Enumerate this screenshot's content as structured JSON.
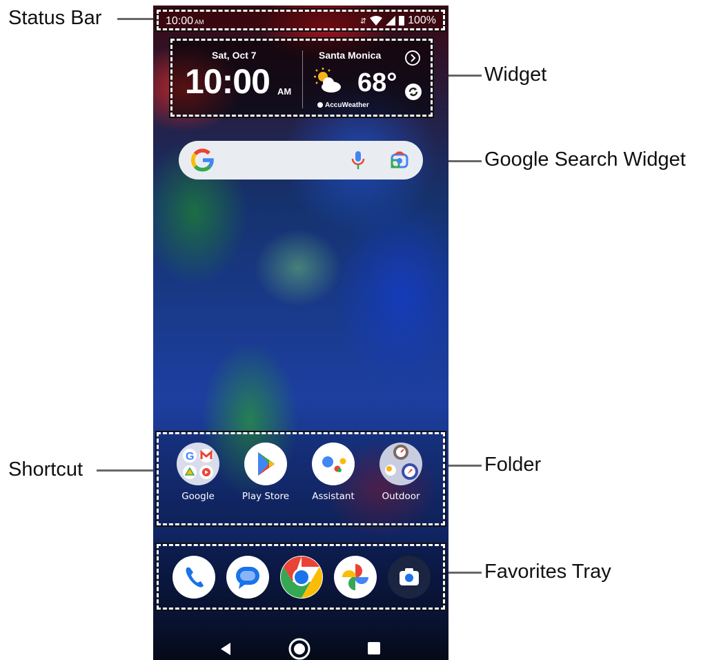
{
  "status_bar": {
    "time": "10:00",
    "ampm": "AM",
    "battery": "100%"
  },
  "widget": {
    "date": "Sat, Oct 7",
    "time": "10:00",
    "ampm": "AM",
    "city": "Santa Monica",
    "temperature": "68°",
    "brand": "AccuWeather"
  },
  "shortcuts": [
    {
      "label": "Google"
    },
    {
      "label": "Play Store"
    },
    {
      "label": "Assistant"
    },
    {
      "label": "Outdoor"
    }
  ],
  "callouts": {
    "status_bar": "Status Bar",
    "widget": "Widget",
    "google_search_widget": "Google Search Widget",
    "shortcut": "Shortcut",
    "folder": "Folder",
    "favorites_tray": "Favorites Tray"
  },
  "colors": {
    "accent_red": "#8b1420",
    "google_blue": "#4285f4",
    "google_red": "#ea4335",
    "google_yellow": "#fbbc05",
    "google_green": "#34a853"
  }
}
